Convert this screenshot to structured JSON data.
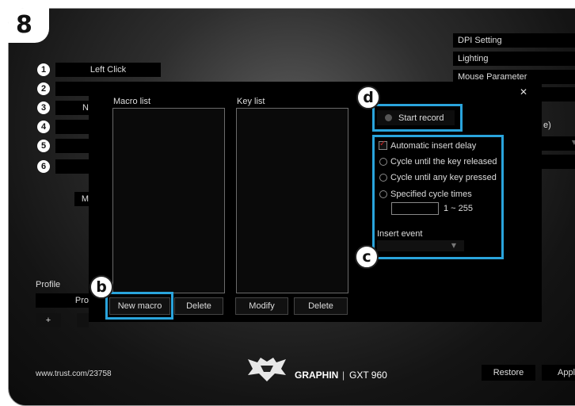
{
  "step": "8",
  "buttons": [
    {
      "num": "1",
      "label": "Left Click"
    },
    {
      "num": "2",
      "label": ""
    },
    {
      "num": "3",
      "label": "N"
    },
    {
      "num": "4",
      "label": ""
    },
    {
      "num": "5",
      "label": ""
    },
    {
      "num": "6",
      "label": ""
    }
  ],
  "left_partial_m": "M",
  "right_menu": [
    "DPI Setting",
    "Lighting",
    "Mouse Parameter"
  ],
  "right_partial_e": "e)",
  "profile": {
    "label": "Profile",
    "name_partial": "Pro",
    "add": "+"
  },
  "dialog": {
    "close": "✕",
    "macro_list_label": "Macro list",
    "key_list_label": "Key list",
    "new_macro": "New macro",
    "delete_macro": "Delete",
    "modify": "Modify",
    "delete_key": "Delete",
    "start_record": "Start record",
    "automatic_insert_delay": "Automatic insert delay",
    "cycle_key_released": "Cycle until the key released",
    "cycle_any_key": "Cycle until any key pressed",
    "specified_cycle_times": "Specified cycle times",
    "cycle_range": "1 ~ 255",
    "insert_event": "Insert event"
  },
  "badges": {
    "b": "b",
    "c": "c",
    "d": "d"
  },
  "footer": {
    "url": "www.trust.com/23758",
    "brand": "GRAPHIN",
    "separator": "|",
    "model": "GXT 960",
    "restore": "Restore",
    "apply_partial": "Appl"
  },
  "colors": {
    "highlight": "#2aa4dc",
    "checkbox": "#cc2222"
  }
}
